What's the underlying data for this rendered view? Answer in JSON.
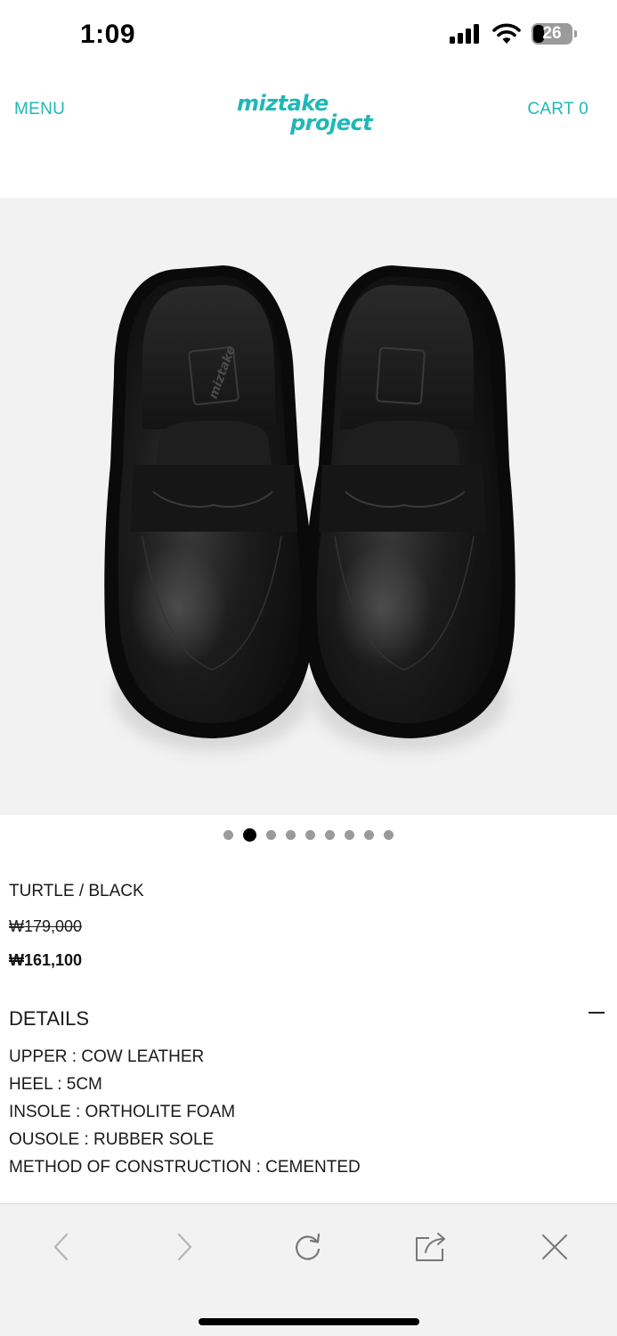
{
  "status": {
    "time": "1:09",
    "battery": "26"
  },
  "header": {
    "menu_label": "MENU",
    "logo_line1": "miztake",
    "logo_line2": "project",
    "cart_label": "CART 0"
  },
  "carousel": {
    "total": 9,
    "active_index": 1
  },
  "product": {
    "name": "TURTLE / BLACK",
    "original_price": "₩179,000",
    "sale_price": "₩161,100",
    "insole_logo_text": "miztake"
  },
  "details": {
    "title": "DETAILS",
    "lines": [
      "UPPER : COW LEATHER",
      "HEEL : 5CM",
      "INSOLE : ORTHOLITE FOAM",
      "OUSOLE : RUBBER SOLE",
      "METHOD OF CONSTRUCTION : CEMENTED"
    ]
  },
  "colors": {
    "brand": "#1fb7b7",
    "toolbar_bg": "#f2f2f2",
    "image_bg": "#f2f2f2"
  },
  "toolbar": {
    "icons": [
      "back-icon",
      "forward-icon",
      "reload-icon",
      "share-icon",
      "close-icon"
    ]
  }
}
